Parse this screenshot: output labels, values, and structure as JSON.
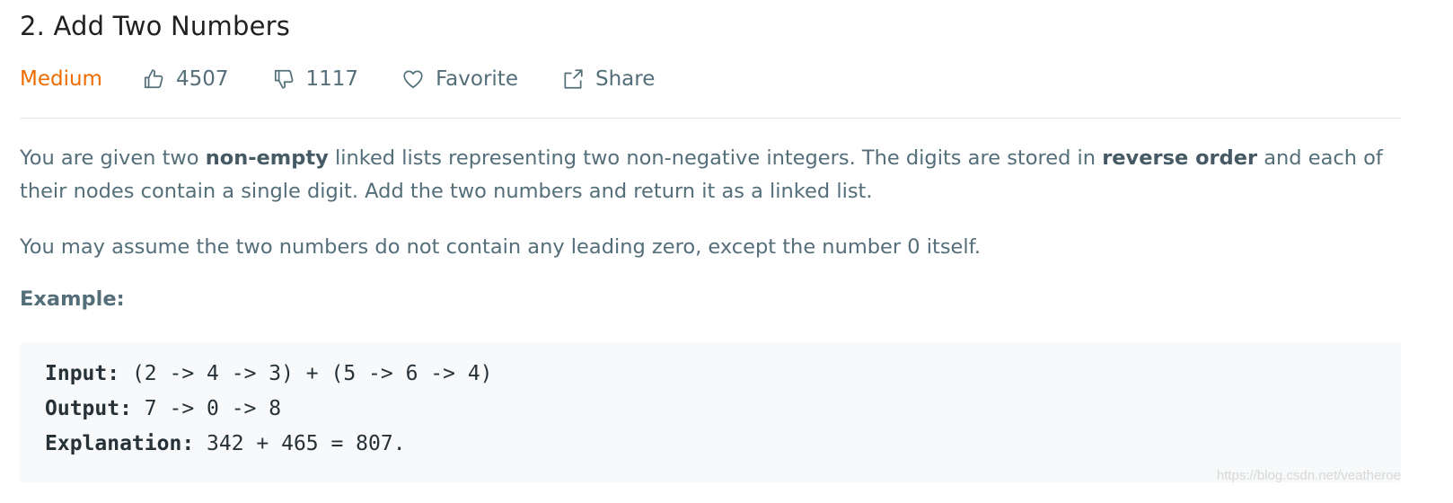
{
  "problem": {
    "title": "2. Add Two Numbers",
    "difficulty": "Medium",
    "likes": "4507",
    "dislikes": "1117",
    "favorite_label": "Favorite",
    "share_label": "Share"
  },
  "description": {
    "p1_part1": "You are given two ",
    "p1_bold1": "non-empty",
    "p1_part2": " linked lists representing two non-negative integers. The digits are stored in ",
    "p1_bold2": "reverse order",
    "p1_part3": " and each of their nodes contain a single digit. Add the two numbers and return it as a linked list.",
    "p2": "You may assume the two numbers do not contain any leading zero, except the number 0 itself."
  },
  "example": {
    "label": "Example:",
    "input_key": "Input:",
    "input_value": " (2 -> 4 -> 3) + (5 -> 6 -> 4)",
    "output_key": "Output:",
    "output_value": " 7 -> 0 -> 8",
    "explanation_key": "Explanation:",
    "explanation_value": " 342 + 465 = 807."
  },
  "watermark": "https://blog.csdn.net/veatheroe",
  "colors": {
    "difficulty_medium": "#ef6c00",
    "meta_text": "#546e7a",
    "code_background": "#f7f9fa"
  },
  "icons": {
    "like": "thumbs-up-icon",
    "dislike": "thumbs-down-icon",
    "favorite": "heart-icon",
    "share": "share-icon"
  }
}
